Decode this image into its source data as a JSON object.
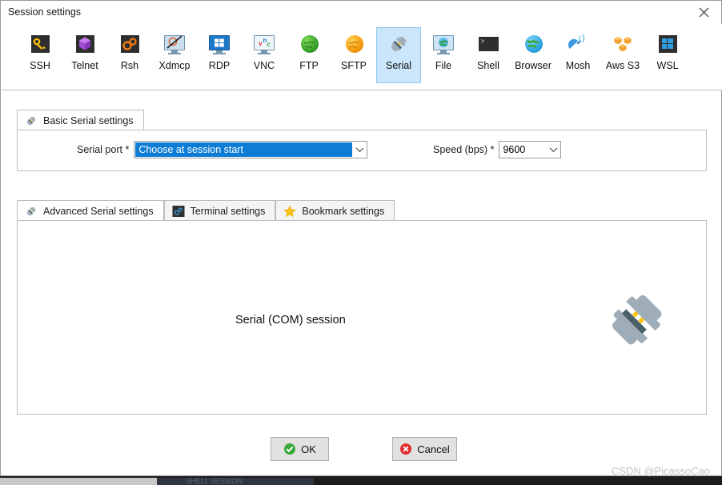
{
  "window": {
    "title": "Session settings",
    "close_label": "close-icon"
  },
  "protocols": [
    {
      "label": "SSH",
      "icon": "key-icon",
      "selected": false
    },
    {
      "label": "Telnet",
      "icon": "cube-icon",
      "selected": false
    },
    {
      "label": "Rsh",
      "icon": "gears-icon",
      "selected": false
    },
    {
      "label": "Xdmcp",
      "icon": "x-monitor-icon",
      "selected": false
    },
    {
      "label": "RDP",
      "icon": "windows-monitor-icon",
      "selected": false
    },
    {
      "label": "VNC",
      "icon": "vnc-monitor-icon",
      "selected": false
    },
    {
      "label": "FTP",
      "icon": "green-globe-icon",
      "selected": false
    },
    {
      "label": "SFTP",
      "icon": "orange-globe-icon",
      "selected": false
    },
    {
      "label": "Serial",
      "icon": "plug-icon",
      "selected": true
    },
    {
      "label": "File",
      "icon": "file-monitor-icon",
      "selected": false
    },
    {
      "label": "Shell",
      "icon": "terminal-icon",
      "selected": false
    },
    {
      "label": "Browser",
      "icon": "blue-globe-icon",
      "selected": false
    },
    {
      "label": "Mosh",
      "icon": "satellite-icon",
      "selected": false
    },
    {
      "label": "Aws S3",
      "icon": "aws-cubes-icon",
      "selected": false
    },
    {
      "label": "WSL",
      "icon": "windows-icon",
      "selected": false
    }
  ],
  "basic": {
    "tab_label": "Basic Serial settings",
    "tab_icon": "plug-icon",
    "serial_port_label": "Serial port *",
    "serial_port_value": "Choose at session start",
    "speed_label": "Speed (bps) *",
    "speed_value": "9600"
  },
  "advanced_tabs": [
    {
      "label": "Advanced Serial settings",
      "icon": "plug-icon",
      "active": true
    },
    {
      "label": "Terminal settings",
      "icon": "terminal-settings-icon",
      "active": false
    },
    {
      "label": "Bookmark settings",
      "icon": "star-icon",
      "active": false
    }
  ],
  "content": {
    "session_caption": "Serial (COM) session",
    "illustration": "plug-icon"
  },
  "buttons": {
    "ok_label": "OK",
    "ok_icon": "green-check-icon",
    "cancel_label": "Cancel",
    "cancel_icon": "red-x-icon"
  },
  "watermark": "CSDN @PicassoCao",
  "background_window": {
    "ghost_tab_text": "SHELL SESSION"
  },
  "colors": {
    "selection_blue": "#0c7cd5",
    "selected_tile": "#cbe6fa",
    "ok_green": "#3aa93a",
    "cancel_red": "#e02b2b",
    "accent_yellow": "#ffc40a"
  }
}
